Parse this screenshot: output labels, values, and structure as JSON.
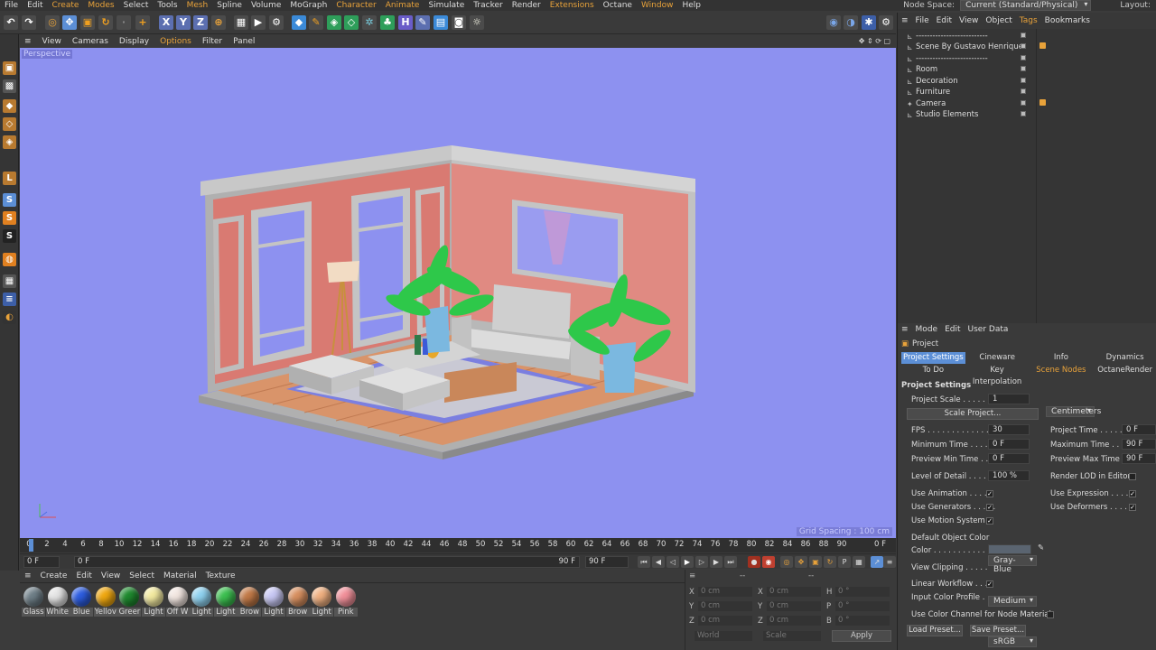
{
  "menubar": {
    "items": [
      "File",
      "Edit",
      "Create",
      "Modes",
      "Select",
      "Tools",
      "Mesh",
      "Spline",
      "Volume",
      "MoGraph",
      "Character",
      "Animate",
      "Simulate",
      "Tracker",
      "Render",
      "Extensions",
      "Octane",
      "Window",
      "Help"
    ],
    "nodespace_label": "Node Space:",
    "nodespace_value": "Current (Standard/Physical)",
    "layout_label": "Layout:"
  },
  "toolbar": {
    "x_label": "X",
    "y_label": "Y",
    "z_label": "Z"
  },
  "viewport_menu": [
    "View",
    "Cameras",
    "Display",
    "Options",
    "Filter",
    "Panel"
  ],
  "viewport": {
    "label": "Perspective",
    "grid_spacing": "Grid Spacing : 100 cm"
  },
  "timeline": {
    "ticks": [
      "0",
      "2",
      "4",
      "6",
      "8",
      "10",
      "12",
      "14",
      "16",
      "18",
      "20",
      "22",
      "24",
      "26",
      "28",
      "30",
      "32",
      "34",
      "36",
      "38",
      "40",
      "42",
      "44",
      "46",
      "48",
      "50",
      "52",
      "54",
      "56",
      "58",
      "60",
      "62",
      "64",
      "66",
      "68",
      "70",
      "72",
      "74",
      "76",
      "78",
      "80",
      "82",
      "84",
      "86",
      "88",
      "90"
    ],
    "end_label": "0 F"
  },
  "playback": {
    "start": "0 F",
    "current": "0 F",
    "end_range": "90 F",
    "end": "90 F"
  },
  "materials": {
    "menu": [
      "Create",
      "Edit",
      "View",
      "Select",
      "Material",
      "Texture"
    ],
    "items": [
      {
        "label": "Glass",
        "color": "#6f7f88"
      },
      {
        "label": "White",
        "color": "#e4e4e4"
      },
      {
        "label": "Blue",
        "color": "#2d5de0"
      },
      {
        "label": "Yellov",
        "color": "#f0a810"
      },
      {
        "label": "Greer",
        "color": "#1f8a2f"
      },
      {
        "label": "Light",
        "color": "#f3eaa0"
      },
      {
        "label": "Off W",
        "color": "#f2e6e0"
      },
      {
        "label": "Light",
        "color": "#8fd2f0"
      },
      {
        "label": "Light",
        "color": "#3cc050"
      },
      {
        "label": "Brow",
        "color": "#c27a48"
      },
      {
        "label": "Light",
        "color": "#c8c8f4"
      },
      {
        "label": "Brow",
        "color": "#d89060"
      },
      {
        "label": "Light",
        "color": "#f0b080"
      },
      {
        "label": "Pink",
        "color": "#f2909a"
      }
    ]
  },
  "coords": {
    "header": "--",
    "x_pos": "0 cm",
    "y_pos": "0 cm",
    "z_pos": "0 cm",
    "x_size": "0 cm",
    "y_size": "0 cm",
    "z_size": "0 cm",
    "h": "0 °",
    "p": "0 °",
    "b": "0 °",
    "x": "X",
    "y": "Y",
    "z": "Z",
    "sx": "X",
    "sy": "Y",
    "sz": "Z",
    "hl": "H",
    "pl": "P",
    "bl": "B",
    "world": "World",
    "scale": "Scale",
    "apply": "Apply"
  },
  "objects": {
    "menu": [
      "File",
      "Edit",
      "View",
      "Object",
      "Tags",
      "Bookmarks"
    ],
    "rows": [
      "--------------------------",
      "Scene By Gustavo Henrique",
      "--------------------------",
      "Room",
      "Decoration",
      "Furniture",
      "Camera",
      "Studio Elements"
    ]
  },
  "attributes": {
    "menu": [
      "Mode",
      "Edit",
      "User Data"
    ],
    "object_label": "Project",
    "tabs1": [
      "Project Settings",
      "Cineware",
      "Info",
      "Dynamics"
    ],
    "tabs2": [
      "To Do",
      "Key Interpolation",
      "Scene Nodes",
      "OctaneRender"
    ],
    "section": "Project Settings",
    "project_scale_label": "Project Scale . . . . . .",
    "project_scale": "1",
    "scale_unit": "Centimeters",
    "scale_project_btn": "Scale Project...",
    "fps_label": "FPS . . . . . . . . . . . . . .",
    "fps": "30",
    "project_time_label": "Project Time . . . . .",
    "project_time": "0 F",
    "min_time_label": "Minimum Time . . . .",
    "min_time": "0 F",
    "max_time_label": "Maximum Time . . .",
    "max_time": "90 F",
    "prev_min_label": "Preview Min Time . .",
    "prev_min": "0 F",
    "prev_max_label": "Preview Max Time .",
    "prev_max": "90 F",
    "lod_label": "Level of Detail . . . . .",
    "lod": "100 %",
    "render_lod_label": "Render LOD in Editor",
    "use_anim_label": "Use Animation . . . . .",
    "use_expr_label": "Use Expression . . . .",
    "use_gen_label": "Use Generators . . . . .",
    "use_def_label": "Use Deformers . . . .",
    "use_motion_label": "Use Motion System",
    "def_color_label": "Default Object Color",
    "def_color": "Gray-Blue",
    "color_label": "Color . . . . . . . . . . . .",
    "view_clip_label": "View Clipping . . . . .",
    "view_clip": "Medium",
    "linear_label": "Linear Workflow . . .",
    "input_color_label": "Input Color Profile .",
    "input_color": "sRGB",
    "node_mat_label": "Use Color Channel for Node Material",
    "load_preset": "Load Preset...",
    "save_preset": "Save Preset..."
  }
}
